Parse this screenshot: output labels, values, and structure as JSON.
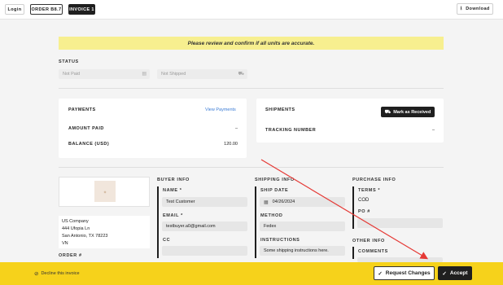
{
  "topbar": {
    "login": "Login",
    "order": "ORDER B8.7",
    "invoice": "INVOICE 1",
    "download": "Download"
  },
  "banner": "Please review and confirm if all units are accurate.",
  "status": {
    "label": "STATUS",
    "payment_placeholder": "Not Paid",
    "shipping_placeholder": "Not Shipped"
  },
  "payments": {
    "title": "PAYMENTS",
    "link": "View Payments",
    "amount_paid_label": "AMOUNT PAID",
    "amount_paid_value": "–",
    "balance_label": "BALANCE (USD)",
    "balance_value": "120.00"
  },
  "shipments": {
    "title": "SHIPMENTS",
    "mark_button": "Mark as Received",
    "tracking_label": "TRACKING NUMBER",
    "tracking_value": "–"
  },
  "address": {
    "lines": [
      "US Company",
      "444 Ufopia Ln",
      "San Antonio, TX 78223",
      "VN"
    ],
    "order_label": "ORDER #"
  },
  "buyer": {
    "title": "BUYER INFO",
    "name_label": "NAME *",
    "name_value": "Test Customer",
    "email_label": "EMAIL *",
    "email_value": "testbuyer.a0@gmail.com",
    "cc_label": "CC",
    "cc_value": ""
  },
  "shipping": {
    "title": "SHIPPING INFO",
    "ship_date_label": "SHIP DATE",
    "ship_date_value": "04/26/2024",
    "method_label": "METHOD",
    "method_value": "Fedex",
    "instructions_label": "INSTRUCTIONS",
    "instructions_value": "Some shipping instructions here."
  },
  "purchase": {
    "title": "PURCHASE INFO",
    "terms_label": "TERMS *",
    "terms_value": "COD",
    "po_label": "PO #",
    "po_value": "",
    "other_title": "OTHER INFO",
    "comments_label": "COMMENTS"
  },
  "footer": {
    "decline": "Decline this invoice",
    "request": "Request Changes",
    "accept": "Accept"
  },
  "colors": {
    "banner": "#f7ef8f",
    "footer": "#f6d21b",
    "annotation_arrow": "#e53935",
    "link": "#3a7bd5"
  }
}
